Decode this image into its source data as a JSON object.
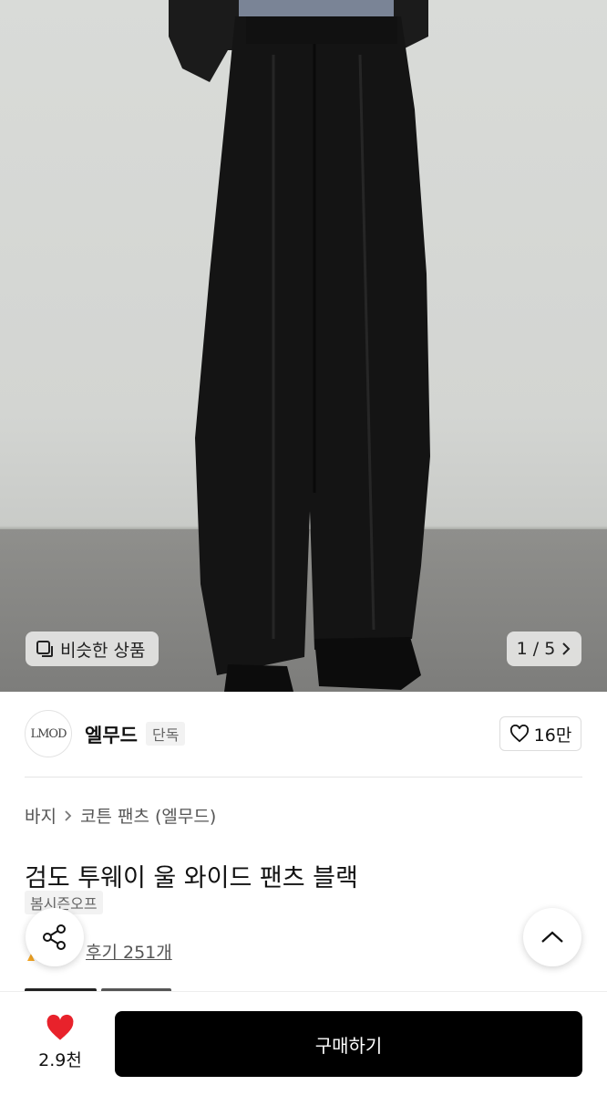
{
  "gallery": {
    "similar_label": "비슷한 상품",
    "counter": "1 / 5"
  },
  "brand": {
    "logo_text": "LMOD",
    "name": "엘무드",
    "badge": "단독",
    "likes": "16만"
  },
  "breadcrumb": {
    "category": "바지",
    "subcategory": "코튼 팬츠 (엘무드)"
  },
  "product": {
    "title": "검도 투웨이 울 와이드 팬츠 블랙",
    "season_tag": "봄시즌오프",
    "reviews": "후기 251개"
  },
  "bottom": {
    "like_count": "2.9천",
    "buy_label": "구매하기"
  },
  "colors": {
    "heart": "#e8222b",
    "buy_button": "#000000"
  }
}
